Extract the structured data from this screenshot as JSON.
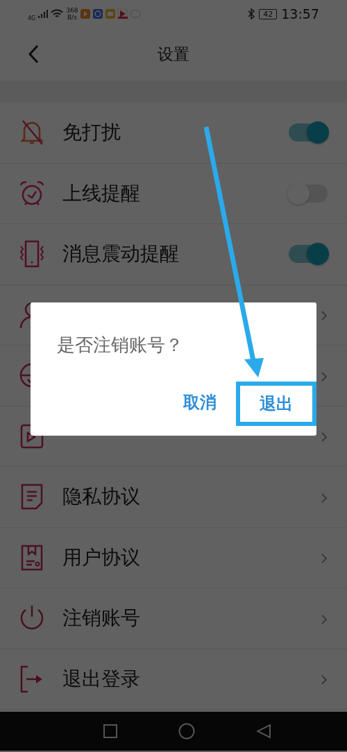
{
  "status_bar": {
    "network": "4G",
    "speed_value": "368",
    "speed_unit": "B/s",
    "battery": "42",
    "time": "13:57"
  },
  "header": {
    "title": "设置"
  },
  "settings": [
    {
      "kind": "toggle",
      "label": "免打扰",
      "on": true
    },
    {
      "kind": "toggle",
      "label": "上线提醒",
      "on": false
    },
    {
      "kind": "toggle",
      "label": "消息震动提醒",
      "on": true
    },
    {
      "kind": "link"
    },
    {
      "kind": "link"
    },
    {
      "kind": "link"
    },
    {
      "kind": "link",
      "label": "隐私协议"
    },
    {
      "kind": "link",
      "label": "用户协议"
    },
    {
      "kind": "link",
      "label": "注销账号"
    },
    {
      "kind": "link",
      "label": "退出登录"
    }
  ],
  "dialog": {
    "message": "是否注销账号？",
    "buttons": [
      {
        "label": "取消",
        "highlighted": false
      },
      {
        "label": "退出",
        "highlighted": true
      }
    ]
  }
}
